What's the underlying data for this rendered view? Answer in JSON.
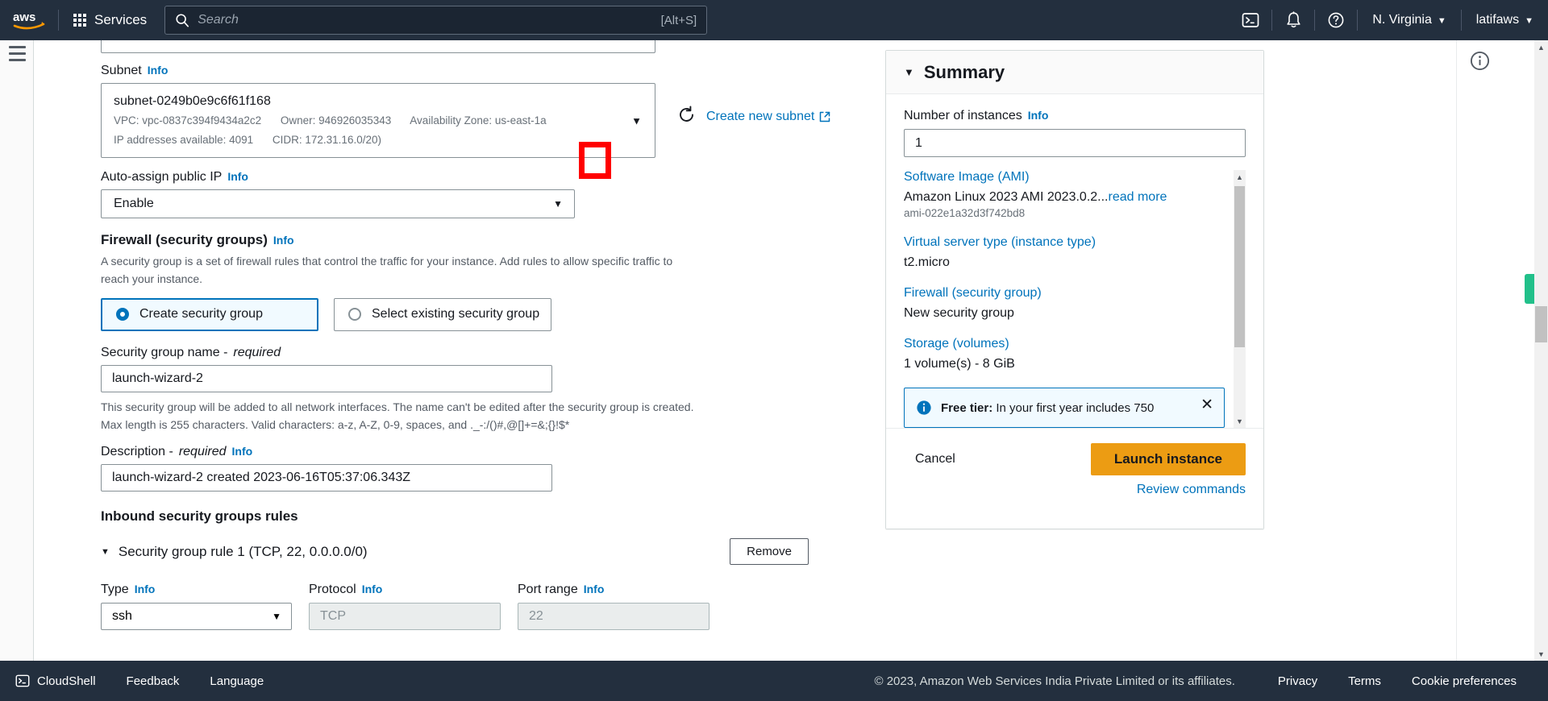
{
  "topnav": {
    "logo": "aws-logo",
    "services_label": "Services",
    "search": {
      "placeholder": "Search",
      "value": "",
      "shortcut": "[Alt+S]"
    },
    "cloudshell_icon": "cloudshell-icon",
    "notifications_icon": "bell-icon",
    "help_icon": "question-circle-icon",
    "region": "N. Virginia",
    "account": "latifaws"
  },
  "form": {
    "subnet": {
      "label": "Subnet",
      "info": "Info",
      "value": "subnet-0249b0e9c6f61f168",
      "meta_vpc": "VPC: vpc-0837c394f9434a2c2",
      "meta_owner": "Owner: 946926035343",
      "meta_az": "Availability Zone: us-east-1a",
      "meta_ips": "IP addresses available: 4091",
      "meta_cidr": "CIDR: 172.31.16.0/20)",
      "refresh_icon": "refresh-icon",
      "create_link": "Create new subnet",
      "external_icon": "external-link-icon"
    },
    "auto_assign_ip": {
      "label": "Auto-assign public IP",
      "info": "Info",
      "value": "Enable"
    },
    "firewall": {
      "label": "Firewall (security groups)",
      "info": "Info",
      "description": "A security group is a set of firewall rules that control the traffic for your instance. Add rules to allow specific traffic to reach your instance.",
      "option_create": "Create security group",
      "option_select": "Select existing security group",
      "selected": "create"
    },
    "sg_name": {
      "label": "Security group name -",
      "required": "required",
      "value": "launch-wizard-2",
      "hint": "This security group will be added to all network interfaces. The name can't be edited after the security group is created. Max length is 255 characters. Valid characters: a-z, A-Z, 0-9, spaces, and ._-:/()#,@[]+=&;{}!$*"
    },
    "sg_description": {
      "label": "Description -",
      "required": "required",
      "info": "Info",
      "value": "launch-wizard-2 created 2023-06-16T05:37:06.343Z"
    },
    "inbound": {
      "title": "Inbound security groups rules",
      "rule_title": "Security group rule 1 (TCP, 22, 0.0.0.0/0)",
      "remove_label": "Remove",
      "type_label": "Type",
      "type_info": "Info",
      "type_value": "ssh",
      "protocol_label": "Protocol",
      "protocol_info": "Info",
      "protocol_value": "TCP",
      "port_label": "Port range",
      "port_info": "Info",
      "port_value": "22"
    }
  },
  "summary": {
    "title": "Summary",
    "collapse_icon": "triangle-down-icon",
    "num_instances_label": "Number of instances",
    "num_instances_info": "Info",
    "num_instances_value": "1",
    "items": [
      {
        "link": "Software Image (AMI)",
        "value": "Amazon Linux 2023 AMI 2023.0.2...",
        "readmore": "read more",
        "sub": "ami-022e1a32d3f742bd8"
      },
      {
        "link": "Virtual server type (instance type)",
        "value": "t2.micro",
        "readmore": "",
        "sub": ""
      },
      {
        "link": "Firewall (security group)",
        "value": "New security group",
        "readmore": "",
        "sub": ""
      },
      {
        "link": "Storage (volumes)",
        "value": "1 volume(s) - 8 GiB",
        "readmore": "",
        "sub": ""
      }
    ],
    "alert": {
      "icon": "info-circle-icon",
      "bold": "Free tier:",
      "text": "In your first year includes 750",
      "close_icon": "close-icon"
    },
    "cancel_label": "Cancel",
    "launch_label": "Launch instance",
    "review_label": "Review commands"
  },
  "right_rail": {
    "info_icon": "info-circle-icon",
    "feedback_tab": "feedback-tab"
  },
  "footer": {
    "cloudshell": "CloudShell",
    "cloudshell_icon": "cloudshell-icon",
    "feedback": "Feedback",
    "language": "Language",
    "copyright": "© 2023, Amazon Web Services India Private Limited or its affiliates.",
    "privacy": "Privacy",
    "terms": "Terms",
    "cookies": "Cookie preferences"
  },
  "annotation": {
    "highlight_color": "#ff0000"
  },
  "colors": {
    "nav_bg": "#232f3e",
    "link": "#0073bb",
    "launch_button": "#ec9c13",
    "accent_green": "#22c08a"
  }
}
